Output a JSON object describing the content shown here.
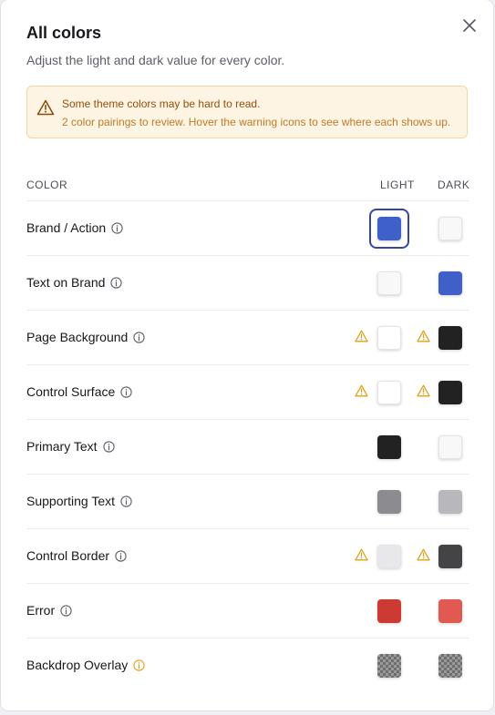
{
  "dialog": {
    "title": "All colors",
    "subtitle": "Adjust the light and dark value for every color.",
    "close_icon": "close-icon"
  },
  "warning": {
    "icon": "warning-triangle-icon",
    "title": "Some theme colors may be hard to read.",
    "text": "2 color pairings to review. Hover the warning icons to see where each shows up."
  },
  "table": {
    "headers": {
      "color": "COLOR",
      "light": "LIGHT",
      "dark": "DARK"
    },
    "rows": [
      {
        "label": "Brand / Action",
        "light": "#3f5fc9",
        "dark": "#f8f8f9",
        "light_warn": false,
        "dark_warn": false,
        "selected": "light",
        "info_accent": false
      },
      {
        "label": "Text on Brand",
        "light": "#f8f8f9",
        "dark": "#3f5fc9",
        "light_warn": false,
        "dark_warn": false,
        "selected": "",
        "info_accent": false
      },
      {
        "label": "Page Background",
        "light": "#ffffff",
        "dark": "#222222",
        "light_warn": true,
        "dark_warn": true,
        "selected": "",
        "info_accent": false
      },
      {
        "label": "Control Surface",
        "light": "#ffffff",
        "dark": "#222222",
        "light_warn": true,
        "dark_warn": true,
        "selected": "",
        "info_accent": false
      },
      {
        "label": "Primary Text",
        "light": "#222222",
        "dark": "#f8f8f9",
        "light_warn": false,
        "dark_warn": false,
        "selected": "",
        "info_accent": false
      },
      {
        "label": "Supporting Text",
        "light": "#8c8c90",
        "dark": "#b8b8bc",
        "light_warn": false,
        "dark_warn": false,
        "selected": "",
        "info_accent": false
      },
      {
        "label": "Control Border",
        "light": "#e8e8ea",
        "dark": "#444447",
        "light_warn": true,
        "dark_warn": true,
        "selected": "",
        "info_accent": false
      },
      {
        "label": "Error",
        "light": "#cc3a33",
        "dark": "#e05a52",
        "light_warn": false,
        "dark_warn": false,
        "selected": "",
        "info_accent": false
      },
      {
        "label": "Backdrop Overlay",
        "light": "checker",
        "dark": "checker",
        "light_warn": false,
        "dark_warn": false,
        "selected": "",
        "info_accent": true
      }
    ]
  },
  "colors": {
    "warn_accent": "#e0a11b",
    "selection_ring": "#3645a8"
  }
}
